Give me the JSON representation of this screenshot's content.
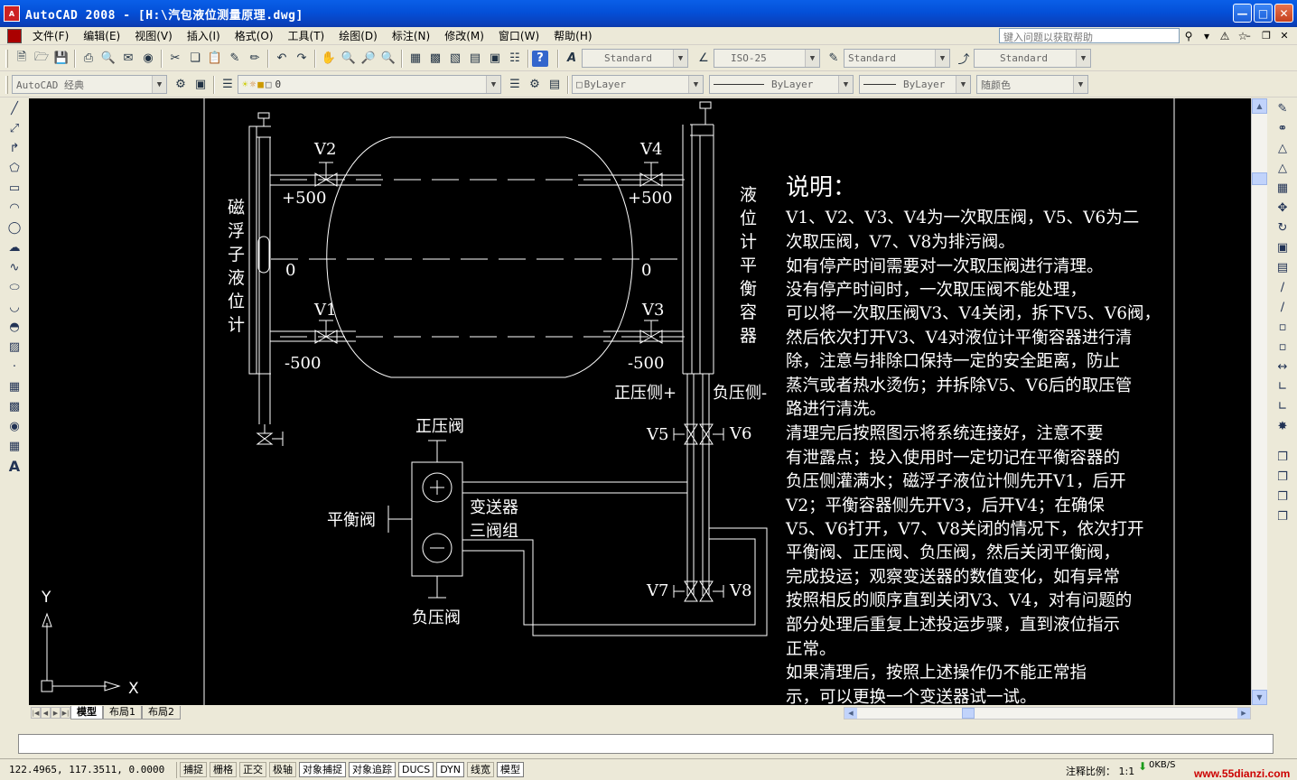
{
  "window": {
    "title": "AutoCAD 2008 - [H:\\汽包液位测量原理.dwg]",
    "icon": "autocad-app-icon",
    "buttons": [
      "minimize",
      "maximize",
      "close"
    ]
  },
  "menu": {
    "items": [
      "文件(F)",
      "编辑(E)",
      "视图(V)",
      "插入(I)",
      "格式(O)",
      "工具(T)",
      "绘图(D)",
      "标注(N)",
      "修改(M)",
      "窗口(W)",
      "帮助(H)"
    ],
    "help_search_placeholder": "键入问题以获取帮助"
  },
  "toolbar_top": {
    "text_style": "Standard",
    "dim_style": "ISO-25",
    "table_style": "Standard",
    "multileader_style": "Standard"
  },
  "toolbar_second": {
    "workspace": "AutoCAD 经典",
    "layer": "0",
    "color": "ByLayer",
    "linetype": "ByLayer",
    "lineweight": "ByLayer",
    "plotstyle": "随颜色"
  },
  "layout_tabs": [
    "模型",
    "布局1",
    "布局2"
  ],
  "active_tab": "模型",
  "status": {
    "coords": "122.4965, 117.3511, 0.0000",
    "toggles": [
      {
        "label": "捕捉",
        "on": false
      },
      {
        "label": "栅格",
        "on": false
      },
      {
        "label": "正交",
        "on": false
      },
      {
        "label": "极轴",
        "on": false
      },
      {
        "label": "对象捕捉",
        "on": true
      },
      {
        "label": "对象追踪",
        "on": true
      },
      {
        "label": "DUCS",
        "on": true
      },
      {
        "label": "DYN",
        "on": true
      },
      {
        "label": "线宽",
        "on": false
      },
      {
        "label": "模型",
        "on": true
      }
    ],
    "annotation_scale_label": "注释比例：",
    "annotation_scale": "1:1",
    "net_speed": "0KB/S",
    "watermark": "www.55dianzi.com"
  },
  "drawing": {
    "left_label_chars": [
      "磁",
      "浮",
      "子",
      "液",
      "位",
      "计"
    ],
    "right_label_chars": [
      "液",
      "位",
      "计",
      "平",
      "衡",
      "容",
      "器"
    ],
    "valves": {
      "v1": "V1",
      "v2": "V2",
      "v3": "V3",
      "v4": "V4",
      "v5": "V5",
      "v6": "V6",
      "v7": "V7",
      "v8": "V8"
    },
    "levels": {
      "plus": "+500",
      "zero": "0",
      "minus": "-500"
    },
    "positive_side": "正压侧+",
    "negative_side": "负压侧-",
    "positive_valve": "正压阀",
    "negative_valve": "负压阀",
    "balance_valve": "平衡阀",
    "transmitter_line1": "变送器",
    "transmitter_line2": "三阀组",
    "ucs_x": "X",
    "ucs_y": "Y"
  },
  "notes": {
    "title": "说明：",
    "lines": [
      "    V1、V2、V3、V4为一次取压阀，V5、V6为二",
      "次取压阀，V7、V8为排污阀。",
      "    如有停产时间需要对一次取压阀进行清理。",
      "    没有停产时间时，一次取压阀不能处理，",
      "可以将一次取压阀V3、V4关闭，拆下V5、V6阀，",
      "然后依次打开V3、V4对液位计平衡容器进行清",
      "除，注意与排除口保持一定的安全距离，防止",
      "蒸汽或者热水烫伤；并拆除V5、V6后的取压管",
      "路进行清洗。",
      "    清理完后按照图示将系统连接好，注意不要",
      "有泄露点；投入使用时一定切记在平衡容器的",
      "负压侧灌满水；磁浮子液位计侧先开V1，后开",
      "V2；平衡容器侧先开V3，后开V4；在确保",
      "V5、V6打开，V7、V8关闭的情况下，依次打开",
      "平衡阀、正压阀、负压阀，然后关闭平衡阀，",
      "完成投运；观察变送器的数值变化，如有异常",
      "按照相反的顺序直到关闭V3、V4，对有问题的",
      "部分处理后重复上述投运步骤，直到液位指示",
      "正常。",
      "    如果清理后，按照上述操作仍不能正常指",
      "示，可以更换一个变送器试一试。"
    ]
  }
}
